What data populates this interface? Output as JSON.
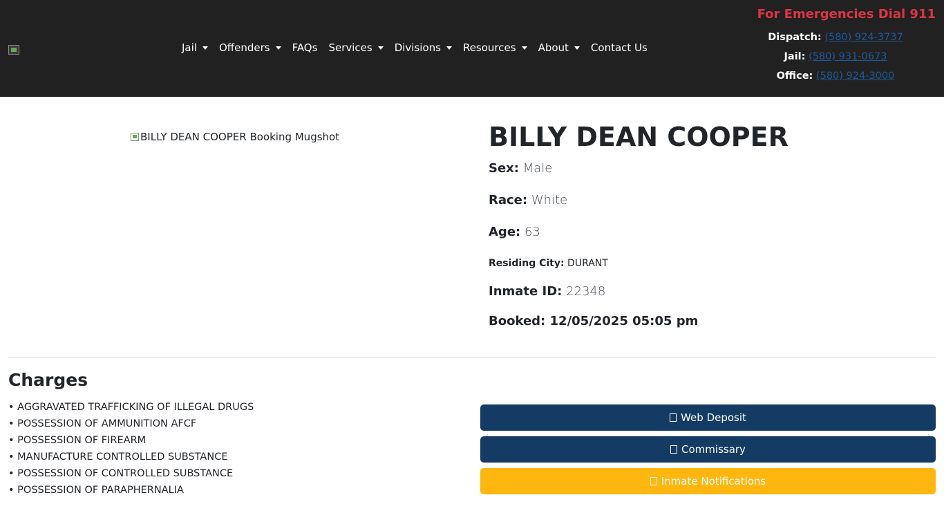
{
  "header": {
    "nav": [
      {
        "label": "Jail",
        "dropdown": true
      },
      {
        "label": "Offenders",
        "dropdown": true
      },
      {
        "label": "FAQs",
        "dropdown": false
      },
      {
        "label": "Services",
        "dropdown": true
      },
      {
        "label": "Divisions",
        "dropdown": true
      },
      {
        "label": "Resources",
        "dropdown": true
      },
      {
        "label": "About",
        "dropdown": true
      },
      {
        "label": "Contact Us",
        "dropdown": false
      }
    ],
    "emergency": "For Emergencies Dial 911",
    "phones": {
      "dispatch": {
        "label": "Dispatch:",
        "number": "(580) 924-3737"
      },
      "jail": {
        "label": "Jail:",
        "number": "(580) 931-0673"
      },
      "office": {
        "label": "Office:",
        "number": "(580) 924-3000"
      }
    }
  },
  "inmate": {
    "mugshot_alt": "BILLY DEAN COOPER Booking Mugshot",
    "name": "BILLY DEAN COOPER",
    "sex_label": "Sex:",
    "sex": "Male",
    "race_label": "Race:",
    "race": "White",
    "age_label": "Age:",
    "age": "63",
    "city_label": "Residing City:",
    "city": "DURANT",
    "id_label": "Inmate ID:",
    "id": "22348",
    "booked_label": "Booked:",
    "booked": "12/05/2025 05:05 pm"
  },
  "charges": {
    "title": "Charges",
    "items": [
      "• AGGRAVATED TRAFFICKING OF ILLEGAL DRUGS",
      "• POSSESSION OF AMMUNITION AFCF",
      "• POSSESSION OF FIREARM",
      "• MANUFACTURE CONTROLLED SUBSTANCE",
      "• POSSESSION OF CONTROLLED SUBSTANCE",
      "• POSSESSION OF PARAPHERNALIA"
    ]
  },
  "actions": {
    "web_deposit": "Web Deposit",
    "commissary": "Commissary",
    "notifications": "Inmate Notifications"
  },
  "colors": {
    "navbar": "#212121",
    "emergency": "#dc3545",
    "primary_button": "#133b63",
    "notify_button": "#ffb60f"
  }
}
